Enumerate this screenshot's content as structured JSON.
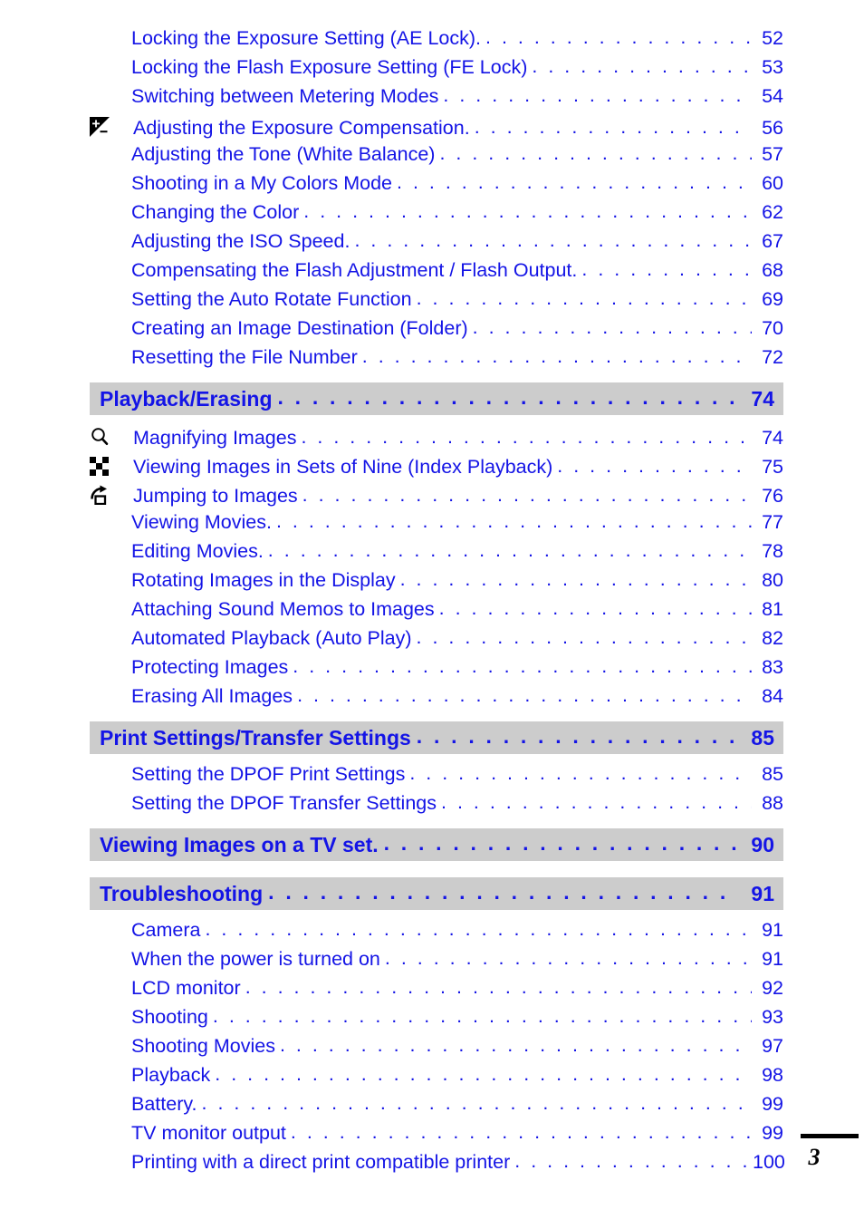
{
  "document": {
    "page_number": "3",
    "accent_color": "#1414e6",
    "band_color": "#cccccc"
  },
  "toc": {
    "groups": [
      {
        "type": "entries",
        "entries": [
          {
            "icon": null,
            "label": "Locking the Exposure Setting (AE Lock).",
            "page": "52"
          },
          {
            "icon": null,
            "label": "Locking the Flash Exposure Setting (FE Lock)",
            "page": "53"
          },
          {
            "icon": null,
            "label": "Switching between Metering Modes",
            "page": "54"
          },
          {
            "icon": "exposure-compensation-icon",
            "label": "Adjusting the Exposure Compensation.",
            "page": "56"
          },
          {
            "icon": null,
            "label": "Adjusting the Tone (White Balance)",
            "page": "57"
          },
          {
            "icon": null,
            "label": "Shooting in a My Colors Mode",
            "page": "60"
          },
          {
            "icon": null,
            "label": "Changing the Color",
            "page": "62"
          },
          {
            "icon": null,
            "label": "Adjusting the ISO Speed.",
            "page": "67"
          },
          {
            "icon": null,
            "label": "Compensating the Flash Adjustment / Flash Output.",
            "page": "68"
          },
          {
            "icon": null,
            "label": "Setting the Auto Rotate Function",
            "page": "69"
          },
          {
            "icon": null,
            "label": "Creating an Image Destination (Folder)",
            "page": "70"
          },
          {
            "icon": null,
            "label": "Resetting the File Number",
            "page": "72"
          }
        ]
      },
      {
        "type": "section",
        "title": "Playback/Erasing",
        "page": "74",
        "entries": [
          {
            "icon": "magnify-icon",
            "label": "Magnifying Images",
            "page": "74"
          },
          {
            "icon": "index-playback-icon",
            "label": "Viewing Images in Sets of Nine (Index Playback)",
            "page": "75"
          },
          {
            "icon": "jump-icon",
            "label": "Jumping to Images",
            "page": "76"
          },
          {
            "icon": null,
            "label": "Viewing Movies.",
            "page": "77"
          },
          {
            "icon": null,
            "label": "Editing Movies.",
            "page": "78"
          },
          {
            "icon": null,
            "label": "Rotating Images in the Display",
            "page": "80"
          },
          {
            "icon": null,
            "label": "Attaching Sound Memos to Images",
            "page": "81"
          },
          {
            "icon": null,
            "label": "Automated Playback (Auto Play)",
            "page": "82"
          },
          {
            "icon": null,
            "label": "Protecting Images",
            "page": "83"
          },
          {
            "icon": null,
            "label": "Erasing All Images",
            "page": "84"
          }
        ]
      },
      {
        "type": "section",
        "title": "Print Settings/Transfer Settings",
        "page": "85",
        "entries": [
          {
            "icon": null,
            "label": "Setting the DPOF Print Settings",
            "page": "85"
          },
          {
            "icon": null,
            "label": "Setting the DPOF Transfer Settings",
            "page": "88"
          }
        ]
      },
      {
        "type": "section",
        "title": "Viewing Images on a TV set.",
        "page": "90",
        "entries": []
      },
      {
        "type": "section",
        "title": "Troubleshooting",
        "page": "91",
        "entries": [
          {
            "icon": null,
            "label": "Camera",
            "page": "91"
          },
          {
            "icon": null,
            "label": "When the power is turned on",
            "page": "91"
          },
          {
            "icon": null,
            "label": "LCD monitor",
            "page": "92"
          },
          {
            "icon": null,
            "label": "Shooting",
            "page": "93"
          },
          {
            "icon": null,
            "label": "Shooting Movies",
            "page": "97"
          },
          {
            "icon": null,
            "label": "Playback",
            "page": "98"
          },
          {
            "icon": null,
            "label": "Battery.",
            "page": "99"
          },
          {
            "icon": null,
            "label": "TV monitor output",
            "page": "99"
          },
          {
            "icon": null,
            "label": "Printing with a direct print compatible printer",
            "page": "100"
          }
        ]
      }
    ]
  }
}
